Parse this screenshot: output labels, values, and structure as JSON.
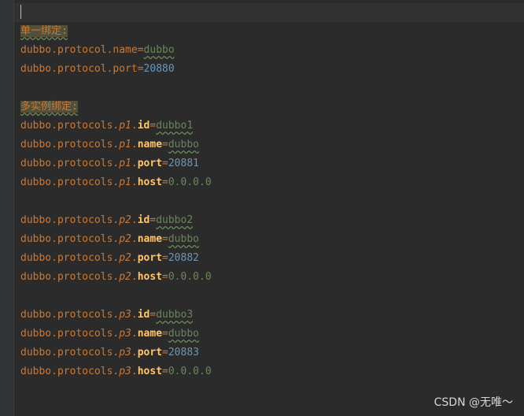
{
  "comments": {
    "single": "单一绑定:",
    "multi": "多实例绑定:"
  },
  "single": {
    "name_key": "dubbo.protocol.name",
    "name_value": "dubbo",
    "port_key": "dubbo.protocol.port",
    "port_value": "20880"
  },
  "prefix": "dubbo.protocols.",
  "groups": [
    {
      "id": "p1",
      "id_value": "dubbo1",
      "name_value": "dubbo",
      "port_value": "20881",
      "host_value": "0.0.0.0"
    },
    {
      "id": "p2",
      "id_value": "dubbo2",
      "name_value": "dubbo",
      "port_value": "20882",
      "host_value": "0.0.0.0"
    },
    {
      "id": "p3",
      "id_value": "dubbo3",
      "name_value": "dubbo",
      "port_value": "20883",
      "host_value": "0.0.0.0"
    }
  ],
  "props": {
    "id": "id",
    "name": "name",
    "port": "port",
    "host": "host"
  },
  "symbols": {
    "dot": ".",
    "eq": "="
  },
  "watermark": "CSDN @无唯～"
}
